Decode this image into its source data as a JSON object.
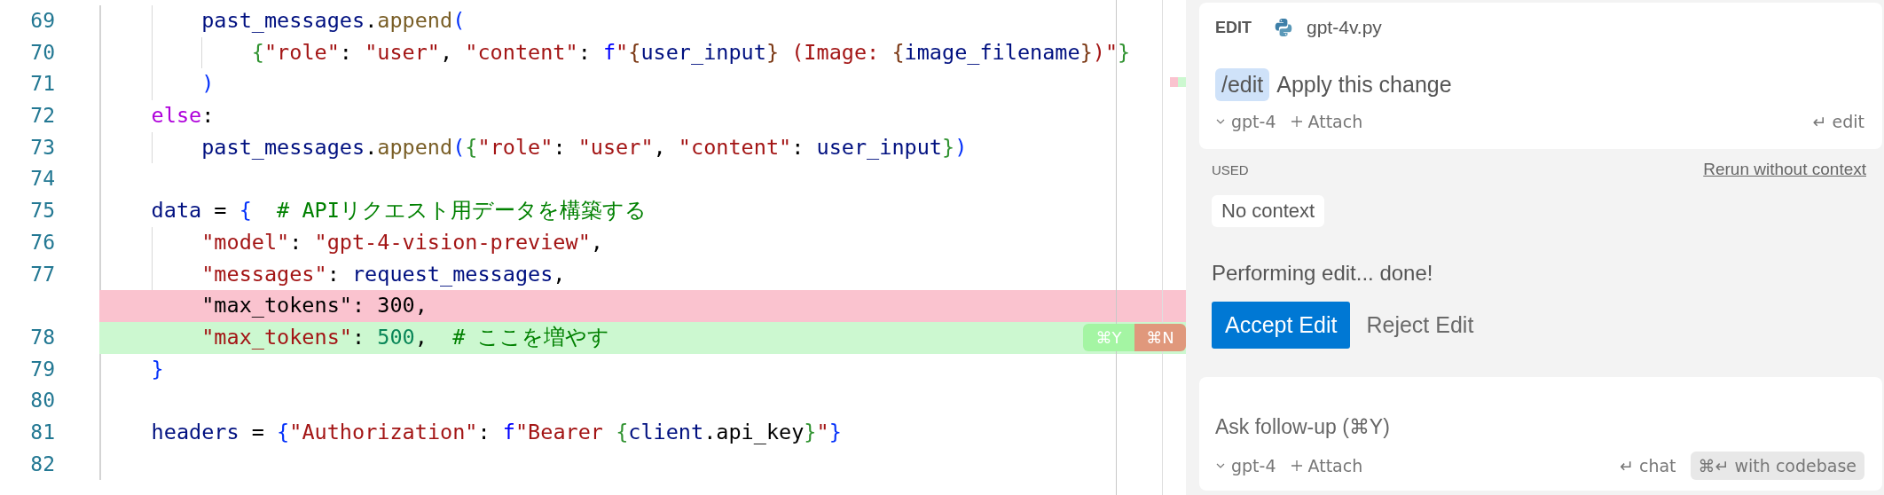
{
  "editor": {
    "lines": [
      {
        "number": "69",
        "added": false,
        "removed": false,
        "tokens": [
          {
            "kind": "var",
            "text": "        past_messages"
          },
          {
            "kind": "plain",
            "text": "."
          },
          {
            "kind": "func",
            "text": "append"
          },
          {
            "kind": "b1",
            "text": "("
          }
        ]
      },
      {
        "number": "70",
        "added": false,
        "removed": false,
        "tokens": [
          {
            "kind": "b2",
            "text": "            {"
          },
          {
            "kind": "str",
            "text": "\"role\""
          },
          {
            "kind": "plain",
            "text": ": "
          },
          {
            "kind": "str",
            "text": "\"user\""
          },
          {
            "kind": "plain",
            "text": ", "
          },
          {
            "kind": "str",
            "text": "\"content\""
          },
          {
            "kind": "plain",
            "text": ": "
          },
          {
            "kind": "fprefix",
            "text": "f"
          },
          {
            "kind": "str",
            "text": "\""
          },
          {
            "kind": "b3",
            "text": "{"
          },
          {
            "kind": "var",
            "text": "user_input"
          },
          {
            "kind": "b3",
            "text": "}"
          },
          {
            "kind": "str",
            "text": " (Image: "
          },
          {
            "kind": "b3",
            "text": "{"
          },
          {
            "kind": "var",
            "text": "image_filename"
          },
          {
            "kind": "b3",
            "text": "}"
          },
          {
            "kind": "str",
            "text": ")\""
          },
          {
            "kind": "b2",
            "text": "}"
          }
        ]
      },
      {
        "number": "71",
        "added": false,
        "removed": false,
        "tokens": [
          {
            "kind": "b1",
            "text": "        )"
          }
        ]
      },
      {
        "number": "72",
        "added": false,
        "removed": false,
        "tokens": [
          {
            "kind": "kw",
            "text": "    else"
          },
          {
            "kind": "plain",
            "text": ":"
          }
        ]
      },
      {
        "number": "73",
        "added": false,
        "removed": false,
        "tokens": [
          {
            "kind": "var",
            "text": "        past_messages"
          },
          {
            "kind": "plain",
            "text": "."
          },
          {
            "kind": "func",
            "text": "append"
          },
          {
            "kind": "b1",
            "text": "("
          },
          {
            "kind": "b2",
            "text": "{"
          },
          {
            "kind": "str",
            "text": "\"role\""
          },
          {
            "kind": "plain",
            "text": ": "
          },
          {
            "kind": "str",
            "text": "\"user\""
          },
          {
            "kind": "plain",
            "text": ", "
          },
          {
            "kind": "str",
            "text": "\"content\""
          },
          {
            "kind": "plain",
            "text": ": "
          },
          {
            "kind": "var",
            "text": "user_input"
          },
          {
            "kind": "b2",
            "text": "}"
          },
          {
            "kind": "b1",
            "text": ")"
          }
        ]
      },
      {
        "number": "74",
        "added": false,
        "removed": false
      },
      {
        "number": "75",
        "added": false,
        "removed": false,
        "tokens": [
          {
            "kind": "var",
            "text": "    data"
          },
          {
            "kind": "plain",
            "text": " = "
          },
          {
            "kind": "b1",
            "text": "{"
          },
          {
            "kind": "comment",
            "text": "  # APIリクエスト用データを構築する"
          }
        ]
      },
      {
        "number": "76",
        "added": false,
        "removed": false,
        "tokens": [
          {
            "kind": "str",
            "text": "        \"model\""
          },
          {
            "kind": "plain",
            "text": ": "
          },
          {
            "kind": "str",
            "text": "\"gpt-4-vision-preview\""
          },
          {
            "kind": "plain",
            "text": ","
          }
        ]
      },
      {
        "number": "77",
        "added": false,
        "removed": false,
        "tokens": [
          {
            "kind": "str",
            "text": "        \"messages\""
          },
          {
            "kind": "plain",
            "text": ": "
          },
          {
            "kind": "var",
            "text": "request_messages"
          },
          {
            "kind": "plain",
            "text": ","
          }
        ]
      },
      {
        "added": false,
        "removed": true,
        "tokens": [
          {
            "kind": "plain",
            "text": "        \"max_tokens\": 300,"
          }
        ]
      },
      {
        "number": "78",
        "added": true,
        "removed": false,
        "tokens": [
          {
            "kind": "str",
            "text": "        \"max_tokens\""
          },
          {
            "kind": "plain",
            "text": ": "
          },
          {
            "kind": "num",
            "text": "500"
          },
          {
            "kind": "plain",
            "text": ",  "
          },
          {
            "kind": "comment",
            "text": "# ここを増やす"
          }
        ],
        "actions": [
          {
            "kind": "accept",
            "label": "⌘Y"
          },
          {
            "kind": "reject",
            "label": "⌘N"
          }
        ]
      },
      {
        "number": "79",
        "added": false,
        "removed": false,
        "tokens": [
          {
            "kind": "b1",
            "text": "    }"
          }
        ]
      },
      {
        "number": "80",
        "added": false,
        "removed": false
      },
      {
        "number": "81",
        "added": false,
        "removed": false,
        "tokens": [
          {
            "kind": "var",
            "text": "    headers"
          },
          {
            "kind": "plain",
            "text": " = "
          },
          {
            "kind": "b1",
            "text": "{"
          },
          {
            "kind": "str",
            "text": "\"Authorization\""
          },
          {
            "kind": "plain",
            "text": ": "
          },
          {
            "kind": "fprefix",
            "text": "f"
          },
          {
            "kind": "str",
            "text": "\"Bearer "
          },
          {
            "kind": "b2",
            "text": "{"
          },
          {
            "kind": "var",
            "text": "client"
          },
          {
            "kind": "plain",
            "text": ".api_key"
          },
          {
            "kind": "b2",
            "text": "}"
          },
          {
            "kind": "str",
            "text": "\""
          },
          {
            "kind": "b1",
            "text": "}"
          }
        ]
      },
      {
        "number": "82",
        "added": false,
        "removed": false
      }
    ]
  },
  "panel": {
    "edit_card": {
      "label": "EDIT",
      "file": "gpt-4v.py",
      "command": "/edit",
      "prompt": "Apply this change",
      "model": "gpt-4",
      "attach": "Attach",
      "submit": "↵ edit"
    },
    "used": {
      "label": "USED",
      "rerun_link": "Rerun without context",
      "context": "No context"
    },
    "status": "Performing edit... done!",
    "buttons": [
      {
        "kind": "primary",
        "label": "Accept Edit"
      },
      {
        "kind": "plain",
        "label": "Reject Edit"
      }
    ],
    "followup_card": {
      "placeholder": "Ask follow-up (⌘Y)",
      "model": "gpt-4",
      "attach": "Attach",
      "chat": "↵ chat",
      "codebase": "⌘↵ with codebase"
    }
  }
}
